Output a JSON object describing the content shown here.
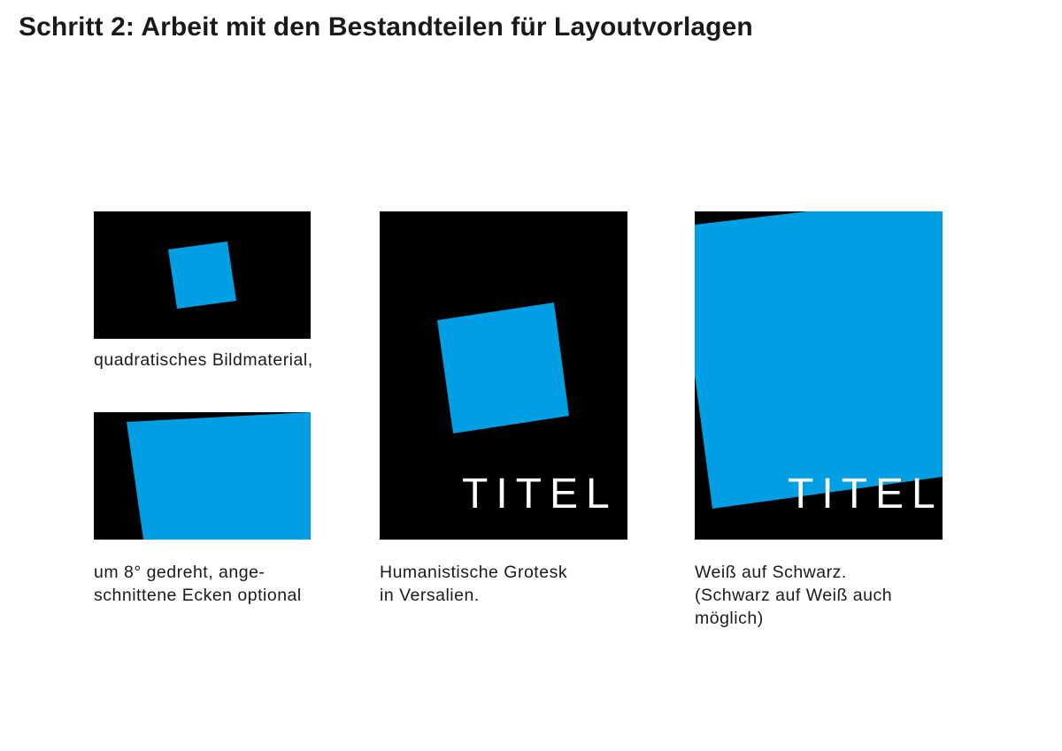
{
  "title": "Schritt 2: Arbeit mit den Bestandteilen für Layoutvorlagen",
  "colors": {
    "panel_background": "#000000",
    "square_blue": "#009fe3",
    "title_text": "#ffffff"
  },
  "panels": [
    {
      "caption_lines": [
        "quadratisches Bildmaterial,"
      ]
    },
    {
      "caption_lines": [
        "um 8° gedreht, ange-",
        "schnittene Ecken optional"
      ]
    },
    {
      "title_text": "TITEL",
      "caption_lines": [
        "Humanistische Grotesk",
        "in Versalien."
      ]
    },
    {
      "title_text": "TITEL",
      "caption_lines": [
        "Weiß auf Schwarz.",
        "(Schwarz auf Weiß auch",
        "möglich)"
      ]
    }
  ]
}
